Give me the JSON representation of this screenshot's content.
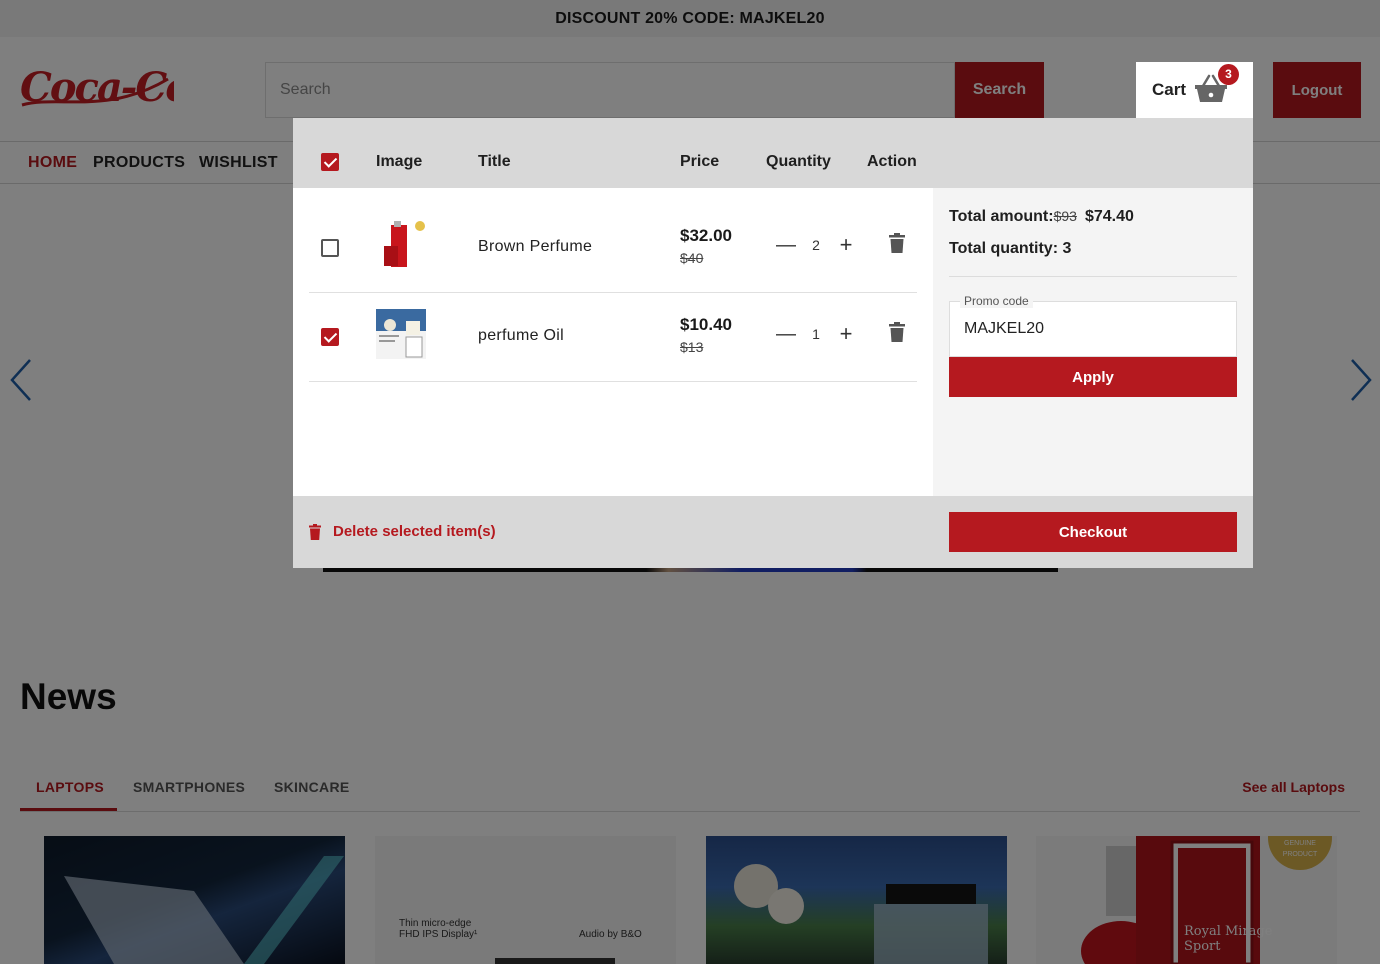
{
  "promo_bar": {
    "text": "DISCOUNT 20% CODE: MAJKEL20"
  },
  "header": {
    "logo_text": "Coca-Cola",
    "search": {
      "placeholder": "Search",
      "value": "",
      "button_label": "Search"
    },
    "cart": {
      "label": "Cart",
      "badge_count": "3"
    },
    "logout_label": "Logout"
  },
  "nav": {
    "items": [
      "HOME",
      "PRODUCTS",
      "WISHLIST"
    ],
    "active": "HOME"
  },
  "news": {
    "title": "News",
    "tabs": [
      "LAPTOPS",
      "SMARTPHONES",
      "SKINCARE"
    ],
    "active_tab": "LAPTOPS",
    "see_all": "See all Laptops",
    "card_texts": {
      "laptop_screen": "Thin micro-edge\nFHD IPS Display¹",
      "laptop_audio": "Audio by B&O",
      "perfume_brand": "Royal Mirage\nSport",
      "seal": "GENUINE PRODUCT"
    }
  },
  "cart_modal": {
    "headers": {
      "image": "Image",
      "title": "Title",
      "price": "Price",
      "quantity": "Quantity",
      "action": "Action"
    },
    "select_all_checked": true,
    "items": [
      {
        "title": "Brown Perfume",
        "price": "$32.00",
        "old_price": "$40",
        "quantity": "2",
        "checked": false,
        "thumb_icon": "perfume-bottle-icon"
      },
      {
        "title": "perfume Oil",
        "price": "$10.40",
        "old_price": "$13",
        "quantity": "1",
        "checked": true,
        "thumb_icon": "perfume-oil-box-icon"
      }
    ],
    "qty_minus": "—",
    "qty_plus": "+",
    "summary": {
      "total_amount_label": "Total amount:",
      "total_amount_old": "$93",
      "total_amount": "$74.40",
      "total_quantity_label": "Total quantity: 3",
      "promo_label": "Promo code",
      "promo_value": "MAJKEL20",
      "apply_label": "Apply"
    },
    "footer": {
      "delete_label": "Delete selected item(s)",
      "checkout_label": "Checkout"
    }
  },
  "colors": {
    "accent": "#b5191f",
    "header_bg": "#d8d8d8",
    "summary_bg": "#f4f4f4",
    "overlay": "rgba(0,0,0,0.5)"
  }
}
